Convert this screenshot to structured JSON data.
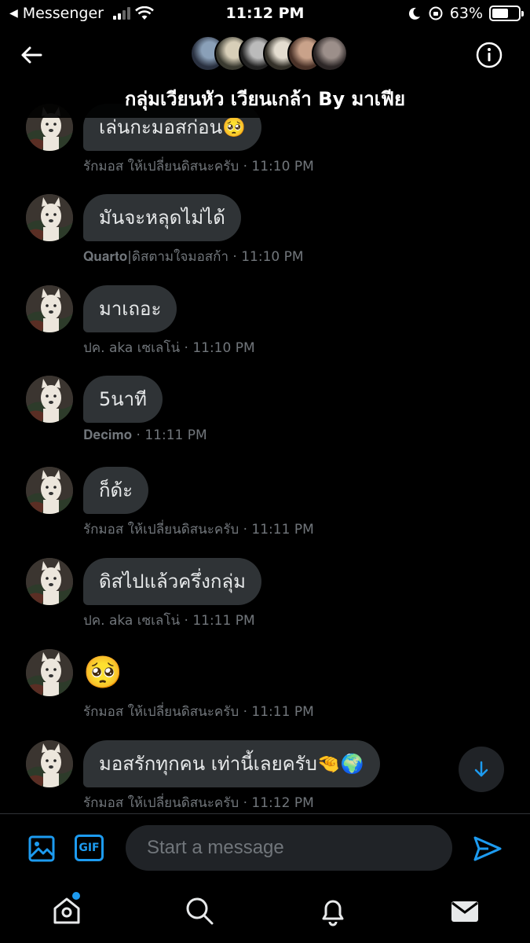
{
  "status_bar": {
    "back_app": "Messenger",
    "time": "11:12 PM",
    "battery_percent": "63%",
    "battery_level": 0.63
  },
  "header": {
    "title": "กลุ่มเวียนหัว เวียนเกล้า By มาเฟีย",
    "participant_avatar_count": 6
  },
  "messages": [
    {
      "text": "เล่นกะมอสก่อน🥺",
      "sender": "รักมอส ให้เปลี่ยนดิสนะครับ",
      "time": "11:10 PM"
    },
    {
      "text": "มันจะหลุดไม่ได้",
      "sender": "𝐐𝐮𝐚𝐫𝐭𝐨|ดิสตามใจมอสก้า",
      "time": "11:10 PM"
    },
    {
      "text": "มาเถอะ",
      "sender": "ปค. aka เซเลโน่",
      "time": "11:10 PM"
    },
    {
      "text": "5นาที",
      "sender": "𝐃𝐞𝐜𝐢𝐦𝐨",
      "time": "11:11 PM"
    },
    {
      "text": "ก็ด้ะ",
      "sender": "รักมอส ให้เปลี่ยนดิสนะครับ",
      "time": "11:11 PM"
    },
    {
      "text": "ดิสไปแล้วครึ่งกลุ่ม",
      "sender": "ปค. aka เซเลโน่",
      "time": "11:11 PM"
    },
    {
      "text": "🥺",
      "sender": "รักมอส ให้เปลี่ยนดิสนะครับ",
      "time": "11:11 PM"
    },
    {
      "text": "มอสรักทุกคน เท่านี้เลยครับ🤏🌍",
      "sender": "รักมอส ให้เปลี่ยนดิสนะครับ",
      "time": "11:12 PM"
    }
  ],
  "meta_separator": " · ",
  "composer": {
    "placeholder": "Start a message",
    "gif_label": "GIF"
  },
  "colors": {
    "accent": "#1d9bf0",
    "bubble": "#2f3336",
    "muted_text": "#71767b",
    "background": "#000000"
  }
}
